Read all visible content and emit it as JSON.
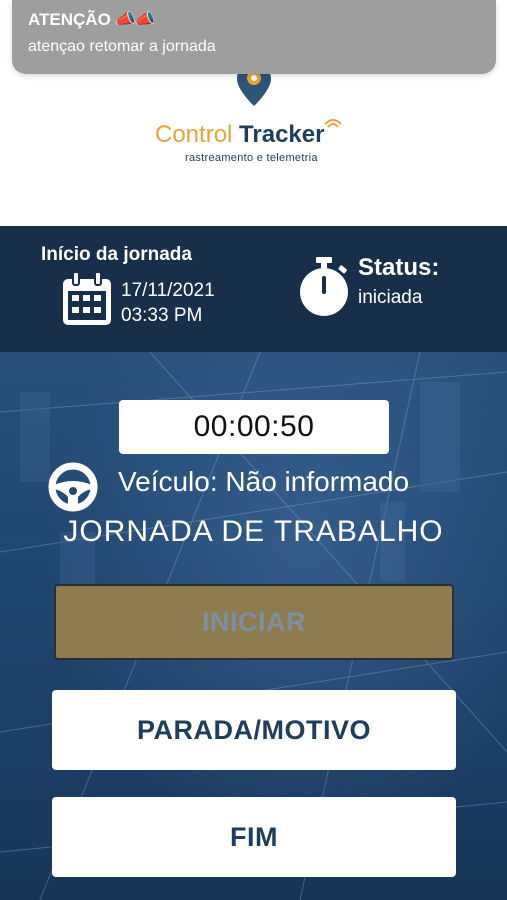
{
  "notification": {
    "title": "ATENÇÃO",
    "title_icons": "📣📣",
    "body": "atençao retomar a jornada"
  },
  "brand": {
    "name_part1": "Control ",
    "name_part2": "Tracker",
    "tagline": "rastreamento e telemetria",
    "accent_color": "#e8a33a",
    "primary_color": "#1f3d5c"
  },
  "journey_info": {
    "start_label": "Início da jornada",
    "date": "17/11/2021",
    "time": "03:33 PM",
    "status_label": "Status:",
    "status_value": "iniciada"
  },
  "main": {
    "timer": "00:00:50",
    "vehicle_text": "Veículo: Não informado",
    "section_title": "JORNADA DE TRABALHO"
  },
  "buttons": {
    "start": "INICIAR",
    "stop_reason": "PARADA/MOTIVO",
    "end": "FIM"
  },
  "icons": {
    "logo": "location-pin-icon",
    "calendar": "calendar-icon",
    "stopwatch": "stopwatch-icon",
    "steering": "steering-wheel-icon"
  }
}
